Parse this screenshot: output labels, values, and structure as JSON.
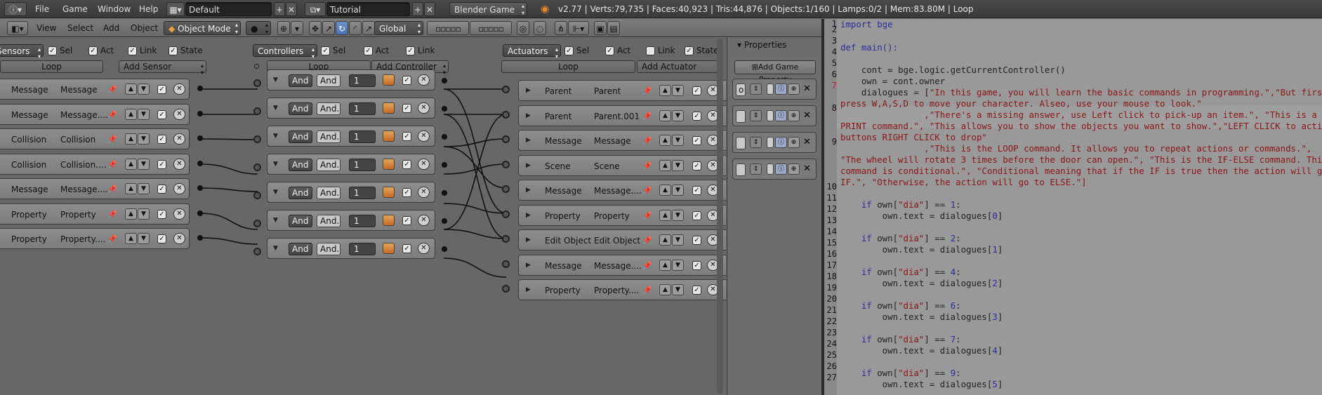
{
  "topbar": {
    "menus": [
      "File",
      "Game",
      "Window",
      "Help"
    ],
    "screen_layout": "Default",
    "scene": "Tutorial",
    "engine": "Blender Game",
    "stats": "v2.77 | Verts:79,735 | Faces:40,923 | Tris:44,876 | Objects:1/160 | Lamps:0/2 | Mem:83.80M | Loop"
  },
  "header2": {
    "menus": [
      "View",
      "Select",
      "Add",
      "Object"
    ],
    "mode": "Object Mode",
    "orientation": "Global"
  },
  "logic": {
    "sensors": {
      "dropdown": "Sensors",
      "sel": "Sel",
      "act": "Act",
      "link": "Link",
      "state": "State",
      "object_name": "Loop",
      "add_label": "Add Sensor",
      "bricks": [
        {
          "type": "Message",
          "name": "Message"
        },
        {
          "type": "Message",
          "name": "Message...."
        },
        {
          "type": "Collision",
          "name": "Collision"
        },
        {
          "type": "Collision",
          "name": "Collision...."
        },
        {
          "type": "Message",
          "name": "Message...."
        },
        {
          "type": "Property",
          "name": "Property"
        },
        {
          "type": "Property",
          "name": "Property...."
        }
      ]
    },
    "controllers": {
      "dropdown": "Controllers",
      "sel": "Sel",
      "act": "Act",
      "link": "Link",
      "object_name": "Loop",
      "add_label": "Add Controller",
      "bricks": [
        {
          "type": "And",
          "name": "And",
          "state": "1"
        },
        {
          "type": "And",
          "name": "And.",
          "state": "1"
        },
        {
          "type": "And",
          "name": "And.",
          "state": "1"
        },
        {
          "type": "And",
          "name": "And.",
          "state": "1"
        },
        {
          "type": "And",
          "name": "And.",
          "state": "1"
        },
        {
          "type": "And",
          "name": "And.",
          "state": "1"
        },
        {
          "type": "And",
          "name": "And.",
          "state": "1"
        }
      ]
    },
    "actuators": {
      "dropdown": "Actuators",
      "sel": "Sel",
      "act": "Act",
      "link": "Link",
      "state": "State",
      "object_name": "Loop",
      "add_label": "Add Actuator",
      "bricks": [
        {
          "type": "Parent",
          "name": "Parent"
        },
        {
          "type": "Parent",
          "name": "Parent.001"
        },
        {
          "type": "Message",
          "name": "Message"
        },
        {
          "type": "Scene",
          "name": "Scene"
        },
        {
          "type": "Message",
          "name": "Message...."
        },
        {
          "type": "Property",
          "name": "Property"
        },
        {
          "type": "Edit Object",
          "name": "Edit Object"
        },
        {
          "type": "Message",
          "name": "Message...."
        },
        {
          "type": "Property",
          "name": "Property...."
        }
      ]
    }
  },
  "properties": {
    "title": "Properties",
    "add_label": "Add Game Property",
    "first_field": "o"
  },
  "editor": {
    "line_numbers": [
      "1",
      "2",
      "3",
      "4",
      "5",
      "6",
      "7",
      "8",
      "9",
      "10",
      "11",
      "12",
      "13",
      "14",
      "15",
      "16",
      "17",
      "18",
      "19",
      "20",
      "21",
      "22",
      "23",
      "24",
      "25",
      "26",
      "27"
    ],
    "lines": {
      "l1": "import bge",
      "l3": "def main():",
      "l5": "    cont = bge.logic.getCurrentController()",
      "l6": "    own = cont.owner",
      "l7a": "    dialogues = [",
      "l7b": "\"In this game, you will learn the basic commands in programming.\",\"But first,",
      "l7c": "press W,A,S,D to move your character. Alseo, use your mouse to look.\"",
      "l8a": "                ,\"There's a missing answer, use Left click to pick-up an item.\", \"This is a",
      "l8b": "PRINT command.\", \"This allows you to show the objects you want to show.\",\"LEFT CLICK to activate",
      "l8c": "buttons RIGHT CLICK to drop\"",
      "l9a": "                ,\"This is the LOOP command. It allows you to repeat actions or commands.\",",
      "l9b": "\"The wheel will rotate 3 times before the door can open.\", \"This is the IF-ELSE command. This",
      "l9c": "command is conditional.\", \"Conditional meaning that if the IF is true then the action will go to",
      "l9d": "IF.\", \"Otherwise, the action will go to ELSE.\"]",
      "if1": "if own[\"dia\"] == ",
      "ifn": [
        "1",
        "2",
        "4",
        "6",
        "7",
        "9"
      ],
      "assign": "own.text = dialogues[",
      "idx": [
        "0",
        "1",
        "2",
        "3",
        "4",
        "5"
      ]
    }
  }
}
